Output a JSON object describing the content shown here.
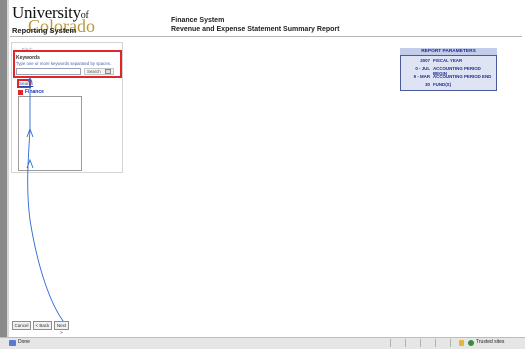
{
  "header": {
    "logo_top": "University",
    "logo_of": "of",
    "logo_bottom": "Colorado",
    "system_name": "Reporting System",
    "app_title": "Finance System",
    "report_title": "Revenue and Expense Statement Summary Report"
  },
  "search_panel": {
    "find_label": "Find:",
    "keywords_label": "Keywords",
    "keywords_hint": "Type one or more keywords separated by spaces.",
    "keyword_value": "",
    "search_button_label": "Search",
    "search_link_label": "Search",
    "tree_label": "Finance"
  },
  "report_parameters": {
    "title": "REPORT PARAMETERS",
    "rows": [
      {
        "value": "2007",
        "name": "FISCAL YEAR"
      },
      {
        "value": "0 - JUL",
        "name": "ACCOUNTING PERIOD BEGIN"
      },
      {
        "value": "9 - MAR",
        "name": "ACCOUNTING PERIOD END"
      },
      {
        "value": "30",
        "name": "FUND(S)"
      }
    ]
  },
  "buttons": {
    "cancel": "Cancel",
    "back": "< Back",
    "next": "Next >"
  },
  "status_bar": {
    "status": "Done",
    "zone": "Trusted sites"
  },
  "colors": {
    "highlight": "#e0252b",
    "annotation": "#2b6ad6",
    "params_header": "#1f2e86",
    "logo_gold": "#b89a3e"
  }
}
